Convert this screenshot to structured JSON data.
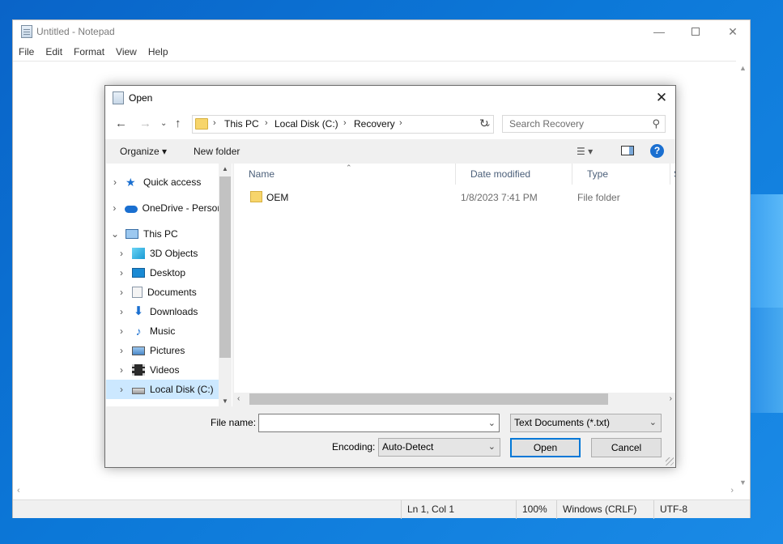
{
  "notepad": {
    "title": "Untitled - Notepad",
    "menu": [
      "File",
      "Edit",
      "Format",
      "View",
      "Help"
    ],
    "window_controls": {
      "minimize": "—",
      "close": "✕"
    },
    "status": {
      "position": "Ln 1, Col 1",
      "zoom": "100%",
      "line_endings": "Windows (CRLF)",
      "encoding": "UTF-8"
    }
  },
  "dialog": {
    "title": "Open",
    "close_glyph": "✕",
    "address": {
      "crumbs": [
        "This PC",
        "Local Disk (C:)",
        "Recovery"
      ]
    },
    "search": {
      "placeholder": "Search Recovery"
    },
    "commands": {
      "organize": "Organize ▾",
      "new_folder": "New folder"
    },
    "tree": [
      {
        "label": "Quick access",
        "icon": "star-icon"
      },
      {
        "label": "OneDrive - Person",
        "icon": "cloud-icon"
      },
      {
        "label": "This PC",
        "icon": "computer-icon"
      },
      {
        "label": "3D Objects",
        "icon": "cube-icon"
      },
      {
        "label": "Desktop",
        "icon": "desktop-icon"
      },
      {
        "label": "Documents",
        "icon": "documents-icon"
      },
      {
        "label": "Downloads",
        "icon": "download-icon"
      },
      {
        "label": "Music",
        "icon": "music-icon"
      },
      {
        "label": "Pictures",
        "icon": "pictures-icon"
      },
      {
        "label": "Videos",
        "icon": "videos-icon"
      },
      {
        "label": "Local Disk (C:)",
        "icon": "disk-icon",
        "selected": true
      }
    ],
    "columns": {
      "name": "Name",
      "date": "Date modified",
      "type": "Type",
      "size": "S"
    },
    "files": [
      {
        "name": "OEM",
        "date": "1/8/2023 7:41 PM",
        "type": "File folder"
      }
    ],
    "file_name": {
      "label": "File name:",
      "value": ""
    },
    "file_type": "Text Documents (*.txt)",
    "encoding": {
      "label": "Encoding:",
      "value": "Auto-Detect"
    },
    "buttons": {
      "open": "Open",
      "cancel": "Cancel"
    }
  },
  "colors": {
    "accent": "#0078d7",
    "selection": "#cce8ff",
    "folder": "#f7d56b",
    "desktop": "#0c78d8"
  }
}
